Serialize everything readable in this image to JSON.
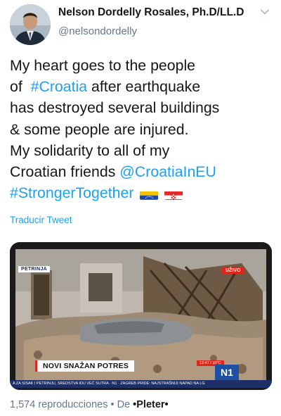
{
  "header": {
    "display_name": "Nelson Dordelly Rosales, Ph.D/LL.D",
    "handle": "@nelsondordelly",
    "menu_icon": "chevron-down-icon",
    "avatar_icon": "avatar"
  },
  "tweet": {
    "lines": [
      {
        "text": "My heart goes to the people"
      },
      {
        "pre": "of  ",
        "link": "#Croatia",
        "post": " after earthquake"
      },
      {
        "text": "has destroyed several buildings"
      },
      {
        "text": "& some people are injured."
      },
      {
        "text": "My solidarity to all of my"
      },
      {
        "pre": "Croatian friends ",
        "link": "@CroatiaInEU"
      },
      {
        "link": "#StrongerTogether"
      }
    ],
    "flags": [
      "venezuela-flag-icon",
      "croatia-flag-icon"
    ],
    "link_color": "#1da1f2"
  },
  "translate_label": "Traducir Tweet",
  "media": {
    "location_tag": "PETRINJA",
    "live_tag": "UŽIVO",
    "headline": "NOVI SNAŽAN POTRES",
    "clock": "12:47 / 10°C",
    "channel_logo": "N1",
    "ticker": "A ZA SISAK I PETRINJU, SREDSTVA IDU VEĆ SUTRA · N1 · ZAGREB PRIDE: NAJSTRAŠNIJI NAPAD NA LG"
  },
  "stats": {
    "views": "1,574 reproducciones",
    "separator": " • De ",
    "author": "•Pleter•"
  }
}
